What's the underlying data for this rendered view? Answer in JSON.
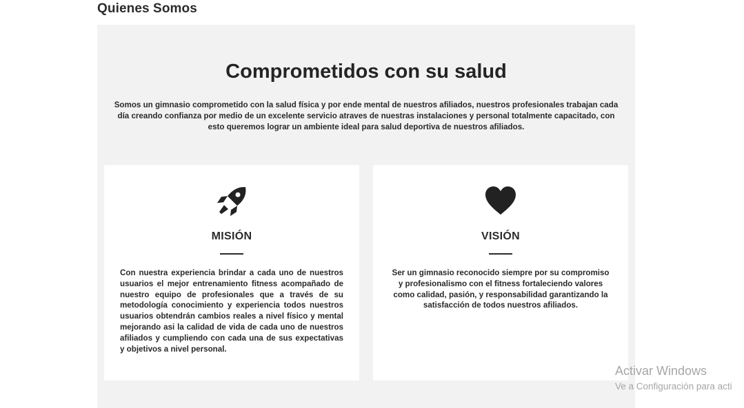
{
  "page": {
    "heading": "Quienes Somos"
  },
  "hero": {
    "title": "Comprometidos con su salud",
    "text": "Somos un gimnasio comprometido con la salud física y por ende mental de nuestros afiliados, nuestros profesionales trabajan cada día creando confianza por medio de un excelente servicio atraves de nuestras instalaciones y personal totalmente capacitado, con esto queremos lograr un ambiente ideal para salud deportiva de nuestros afiliados."
  },
  "cards": [
    {
      "icon": "rocket-icon",
      "title": "MISIÓN",
      "text": "Con nuestra experiencia brindar a cada uno de nuestros usuarios el mejor entrenamiento fitness acompañado de nuestro equipo de profesionales que a través de su metodología conocimiento y experiencia todos nuestros usuarios obtendrán cambios reales a nivel físico y mental mejorando asi la calidad de vida de cada uno de nuestros afiliados  y cumpliendo con cada una de sus expectativas y objetivos a nivel personal."
    },
    {
      "icon": "heart-icon",
      "title": "VISIÓN",
      "text": "Ser un gimnasio reconocido siempre por su compromiso y profesionalismo con el fitness fortaleciendo valores como calidad, pasión, y responsabilidad garantizando la satisfacción de todos nuestros afiliados."
    }
  ],
  "watermark": {
    "title": "Activar Windows",
    "subtitle": "Ve a Configuración para acti"
  },
  "colors": {
    "panel_background": "#f2f2f2",
    "card_background": "#ffffff",
    "text": "#2a2a2a",
    "watermark": "#a6a6a6"
  }
}
